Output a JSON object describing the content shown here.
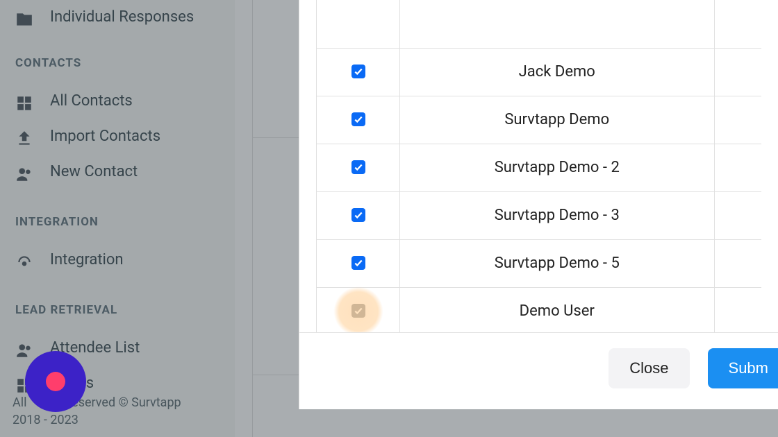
{
  "sidebar": {
    "individual_responses": {
      "label": "Individual Responses"
    },
    "contacts_header": "CONTACTS",
    "all_contacts_label": "All Contacts",
    "import_contacts_label": "Import Contacts",
    "new_contact_label": "New Contact",
    "integration_header": "INTEGRATION",
    "integration_label": "Integration",
    "lead_retrieval_header": "LEAD RETRIEVAL",
    "attendee_list_label": "Attendee List",
    "reports_label": "eports"
  },
  "footer": {
    "line1": "All            Reserved © Survtapp",
    "line2": "2018 - 2023"
  },
  "modal": {
    "rows": [
      {
        "name": "Jack Demo",
        "checked": true,
        "highlighted": false
      },
      {
        "name": "Survtapp Demo",
        "checked": true,
        "highlighted": false
      },
      {
        "name": "Survtapp Demo - 2",
        "checked": true,
        "highlighted": false
      },
      {
        "name": "Survtapp Demo - 3",
        "checked": true,
        "highlighted": false
      },
      {
        "name": "Survtapp Demo - 5",
        "checked": true,
        "highlighted": false
      },
      {
        "name": "Demo User",
        "checked": true,
        "highlighted": true,
        "disabled": true
      }
    ],
    "close_label": "Close",
    "submit_label": "Subm"
  }
}
